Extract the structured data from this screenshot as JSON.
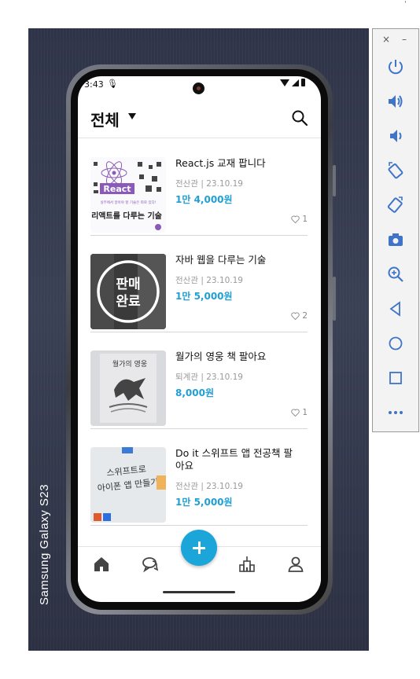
{
  "device": {
    "label": "Samsung Galaxy S23"
  },
  "status_bar": {
    "time": "3:43",
    "mic_glyph": "🎙"
  },
  "header": {
    "title": "전체"
  },
  "items": [
    {
      "title": "React.js 교재 팝니다",
      "meta": "전산관 | 23.10.19",
      "price": "1만 4,000원",
      "likes": "1"
    },
    {
      "title": "자바 웹을 다루는 기술",
      "meta": "전산관 | 23.10.19",
      "price": "1만 5,000원",
      "likes": "2",
      "sold_badge": [
        "판매",
        "완료"
      ]
    },
    {
      "title": "월가의 영웅 책 팔아요",
      "meta": "퇴계관 | 23.10.19",
      "price": "8,000원",
      "likes": "1"
    },
    {
      "title": "Do it 스위프트 앱 전공책 팔아요",
      "meta": "전산관 | 23.10.19",
      "price": "1만 5,000원"
    }
  ],
  "thumbs": {
    "react": {
      "line1": "React",
      "line2": "실무에서 알아야 할 기술은 따로 있다!",
      "line3": "리액트를 다루는 기술"
    },
    "wallstreet": {
      "line1": "월가의 영웅"
    },
    "swift": {
      "line1": "스위프트로",
      "line2": "아이폰 앱 만들기"
    }
  },
  "bottom_nav": [
    "home-icon",
    "chat-icon",
    "add-button",
    "building-icon",
    "profile-icon"
  ],
  "side_panel": {
    "close_glyph": "×",
    "minimize_glyph": "–",
    "tools": [
      "power-icon",
      "volume-up-icon",
      "volume-down-icon",
      "rotate-left-icon",
      "rotate-right-icon",
      "camera-icon",
      "zoom-icon",
      "back-icon",
      "home-circle-icon",
      "overview-icon",
      "more-icon"
    ]
  },
  "colors": {
    "accent": "#1ba5d8",
    "price": "#1f9fd3",
    "background": "#2f3448"
  }
}
